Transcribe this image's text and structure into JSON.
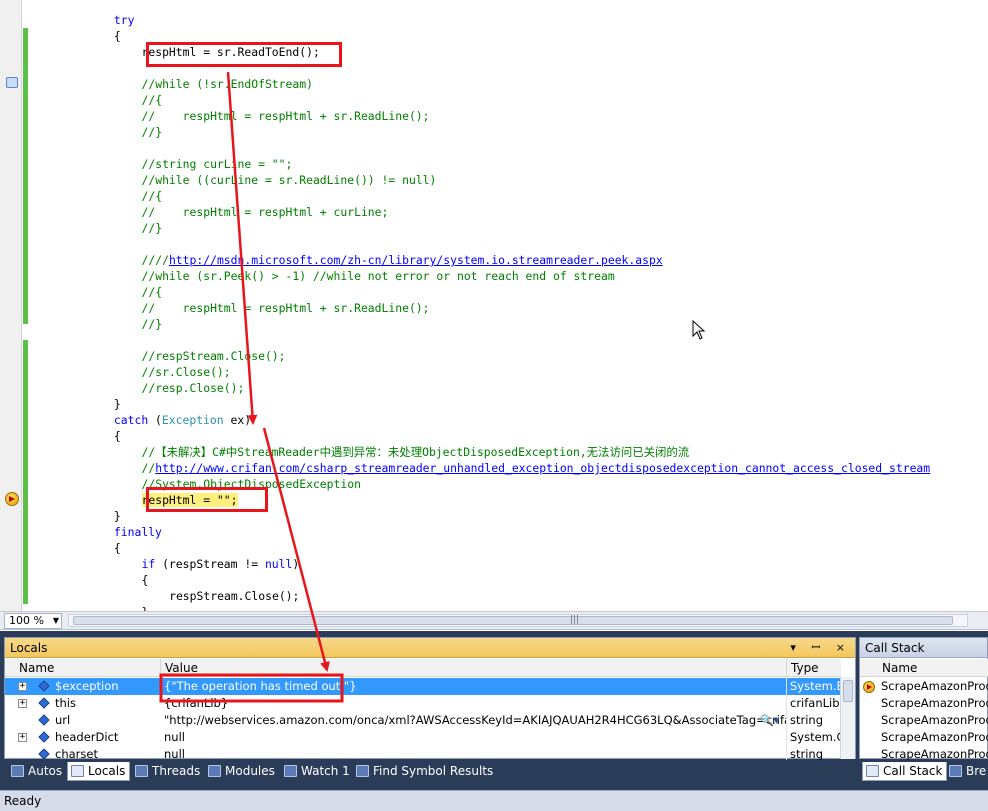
{
  "editor": {
    "lines": [
      {
        "indent": 11,
        "parts": [
          {
            "t": "try",
            "c": "kw"
          }
        ]
      },
      {
        "indent": 11,
        "parts": [
          {
            "t": "{",
            "c": ""
          }
        ]
      },
      {
        "indent": 15,
        "parts": [
          {
            "t": "respHtml = sr.ReadToEnd();",
            "c": ""
          }
        ]
      },
      {
        "indent": 0,
        "parts": []
      },
      {
        "indent": 15,
        "parts": [
          {
            "t": "//while (!sr.EndOfStream)",
            "c": "cm"
          }
        ]
      },
      {
        "indent": 15,
        "parts": [
          {
            "t": "//{",
            "c": "cm"
          }
        ]
      },
      {
        "indent": 15,
        "parts": [
          {
            "t": "//    respHtml = respHtml + sr.ReadLine();",
            "c": "cm"
          }
        ]
      },
      {
        "indent": 15,
        "parts": [
          {
            "t": "//}",
            "c": "cm"
          }
        ]
      },
      {
        "indent": 0,
        "parts": []
      },
      {
        "indent": 15,
        "parts": [
          {
            "t": "//string curLine = \"\";",
            "c": "cm"
          }
        ]
      },
      {
        "indent": 15,
        "parts": [
          {
            "t": "//while ((curLine = sr.ReadLine()) != null)",
            "c": "cm"
          }
        ]
      },
      {
        "indent": 15,
        "parts": [
          {
            "t": "//{",
            "c": "cm"
          }
        ]
      },
      {
        "indent": 15,
        "parts": [
          {
            "t": "//    respHtml = respHtml + curLine;",
            "c": "cm"
          }
        ]
      },
      {
        "indent": 15,
        "parts": [
          {
            "t": "//}",
            "c": "cm"
          }
        ]
      },
      {
        "indent": 0,
        "parts": []
      },
      {
        "indent": 15,
        "parts": [
          {
            "t": "////",
            "c": "cm"
          },
          {
            "t": "http://msdn.microsoft.com/zh-cn/library/system.io.streamreader.peek.aspx",
            "c": "ln"
          }
        ]
      },
      {
        "indent": 15,
        "parts": [
          {
            "t": "//while (sr.Peek() > -1) //while not error or not reach end of stream",
            "c": "cm"
          }
        ]
      },
      {
        "indent": 15,
        "parts": [
          {
            "t": "//{",
            "c": "cm"
          }
        ]
      },
      {
        "indent": 15,
        "parts": [
          {
            "t": "//    respHtml = respHtml + sr.ReadLine();",
            "c": "cm"
          }
        ]
      },
      {
        "indent": 15,
        "parts": [
          {
            "t": "//}",
            "c": "cm"
          }
        ]
      },
      {
        "indent": 0,
        "parts": []
      },
      {
        "indent": 15,
        "parts": [
          {
            "t": "//respStream.Close();",
            "c": "cm"
          }
        ]
      },
      {
        "indent": 15,
        "parts": [
          {
            "t": "//sr.Close();",
            "c": "cm"
          }
        ]
      },
      {
        "indent": 15,
        "parts": [
          {
            "t": "//resp.Close();",
            "c": "cm"
          }
        ]
      },
      {
        "indent": 11,
        "parts": [
          {
            "t": "}",
            "c": ""
          }
        ]
      },
      {
        "indent": 11,
        "parts": [
          {
            "t": "catch",
            "c": "kw"
          },
          {
            "t": " (",
            "c": ""
          },
          {
            "t": "Exception",
            "c": "ty"
          },
          {
            "t": " ex)",
            "c": ""
          }
        ]
      },
      {
        "indent": 11,
        "parts": [
          {
            "t": "{",
            "c": ""
          }
        ]
      },
      {
        "indent": 15,
        "parts": [
          {
            "t": "//【未解决】C#中StreamReader中遇到异常：未处理ObjectDisposedException,无法访问已关闭的流",
            "c": "cm"
          }
        ]
      },
      {
        "indent": 15,
        "parts": [
          {
            "t": "//",
            "c": "cm"
          },
          {
            "t": "http://www.crifan.com/csharp_streamreader_unhandled_exception_objectdisposedexception_cannot_access_closed_stream",
            "c": "ln"
          }
        ]
      },
      {
        "indent": 15,
        "parts": [
          {
            "t": "//System.ObjectDisposedException",
            "c": "cm"
          }
        ]
      },
      {
        "indent": 15,
        "parts": [
          {
            "t": "respHtml = \"\";",
            "c": "hl"
          }
        ]
      },
      {
        "indent": 11,
        "parts": [
          {
            "t": "}",
            "c": ""
          }
        ]
      },
      {
        "indent": 11,
        "parts": [
          {
            "t": "finally",
            "c": "kw"
          }
        ]
      },
      {
        "indent": 11,
        "parts": [
          {
            "t": "{",
            "c": ""
          }
        ]
      },
      {
        "indent": 15,
        "parts": [
          {
            "t": "if",
            "c": "kw"
          },
          {
            "t": " (respStream != ",
            "c": ""
          },
          {
            "t": "null",
            "c": "kw"
          },
          {
            "t": ")",
            "c": ""
          }
        ]
      },
      {
        "indent": 15,
        "parts": [
          {
            "t": "{",
            "c": ""
          }
        ]
      },
      {
        "indent": 19,
        "parts": [
          {
            "t": "respStream.Close();",
            "c": ""
          }
        ]
      },
      {
        "indent": 15,
        "parts": [
          {
            "t": "}",
            "c": ""
          }
        ]
      }
    ]
  },
  "zoom": {
    "value": "100 %"
  },
  "locals": {
    "title": "Locals",
    "columns": {
      "name": "Name",
      "value": "Value",
      "type": "Type"
    },
    "rows": [
      {
        "name": "$exception",
        "value": "{\"The operation has timed out.\"}",
        "type": "System.Exception",
        "expandable": true
      },
      {
        "name": "this",
        "value": "{crifanLib}",
        "type": "crifanLib",
        "expandable": true
      },
      {
        "name": "url",
        "value": "\"http://webservices.amazon.com/onca/xml?AWSAccessKeyId=AKIAJQAUAH2R4HCG63LQ&AssociateTag=crifan",
        "type": "string",
        "expandable": false
      },
      {
        "name": "headerDict",
        "value": "null",
        "type": "System.Collections",
        "expandable": true
      },
      {
        "name": "charset",
        "value": "null",
        "type": "string",
        "expandable": false
      }
    ]
  },
  "callstack": {
    "title": "Call Stack",
    "columns": {
      "name": "Name"
    },
    "rows": [
      "ScrapeAmazonProduct",
      "ScrapeAmazonProduct",
      "ScrapeAmazonProduct",
      "ScrapeAmazonProduct",
      "ScrapeAmazonProduct"
    ]
  },
  "tabs": [
    "Autos",
    "Locals",
    "Threads",
    "Modules",
    "Watch 1",
    "Find Symbol Results"
  ],
  "right_tabs": [
    "Call Stack",
    "Bre"
  ],
  "status": {
    "text": "Ready"
  },
  "colors": {
    "annotation": "#e8161c",
    "selection": "#3399ff",
    "statusbar": "#d6dbe9"
  }
}
